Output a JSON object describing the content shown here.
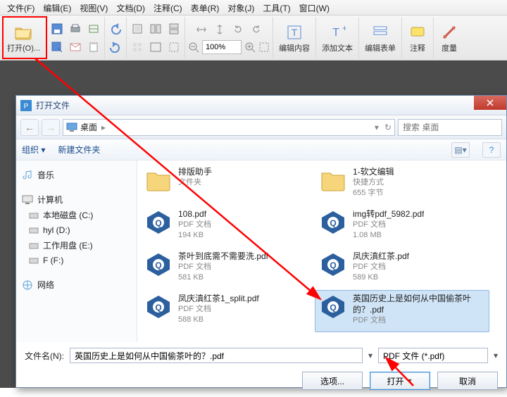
{
  "menubar": [
    "文件(F)",
    "编辑(E)",
    "视图(V)",
    "文档(D)",
    "注释(C)",
    "表单(R)",
    "对象(J)",
    "工具(T)",
    "窗口(W)"
  ],
  "toolbar": {
    "open_label": "打开(O)...",
    "zoom_value": "100%",
    "edit_content": "编辑内容",
    "add_text": "添加文本",
    "edit_form": "编辑表单",
    "annotate": "注释",
    "measure": "度量"
  },
  "dialog": {
    "title": "打开文件",
    "location": "桌面",
    "search_placeholder": "搜索 桌面",
    "organize": "组织 ▾",
    "new_folder": "新建文件夹",
    "sidebar_music": "音乐",
    "sidebar_computer": "计算机",
    "sidebar_drives": [
      "本地磁盘 (C:)",
      "hyl (D:)",
      "工作用盘 (E:)",
      "F (F:)"
    ],
    "sidebar_network": "网络",
    "files": [
      {
        "name": "排版助手",
        "type": "文件夹",
        "size": "",
        "icon": "folder"
      },
      {
        "name": "1-软文编辑",
        "type": "快捷方式",
        "size": "655 字节",
        "icon": "folder"
      },
      {
        "name": "108.pdf",
        "type": "PDF 文档",
        "size": "194 KB",
        "icon": "pdf"
      },
      {
        "name": "img转pdf_5982.pdf",
        "type": "PDF 文档",
        "size": "1.08 MB",
        "icon": "pdf"
      },
      {
        "name": "茶叶到底需不需要洗.pdf",
        "type": "PDF 文档",
        "size": "581 KB",
        "icon": "pdf"
      },
      {
        "name": "凤庆滇红茶.pdf",
        "type": "PDF 文档",
        "size": "589 KB",
        "icon": "pdf"
      },
      {
        "name": "凤庆滇红茶1_split.pdf",
        "type": "PDF 文档",
        "size": "588 KB",
        "icon": "pdf"
      },
      {
        "name": "英国历史上是如何从中国偷茶叶的？.pdf",
        "type": "PDF 文档",
        "size": "",
        "icon": "pdf"
      }
    ],
    "selected_index": 7,
    "filename_label": "文件名(N):",
    "filename_value": "英国历史上是如何从中国偷茶叶的？.pdf",
    "filter": "PDF 文件 (*.pdf)",
    "options_btn": "选项...",
    "open_btn": "打开",
    "cancel_btn": "取消"
  }
}
